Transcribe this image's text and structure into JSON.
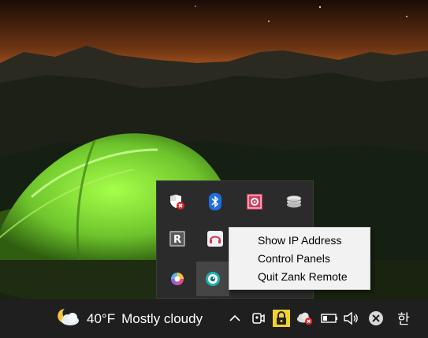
{
  "context_menu": {
    "items": [
      {
        "label": "Show IP Address"
      },
      {
        "label": "Control Panels"
      },
      {
        "label": "Quit Zank Remote"
      }
    ]
  },
  "tray_overflow": {
    "icons": [
      {
        "icon": "windows-security-shield-icon"
      },
      {
        "icon": "bluetooth-icon"
      },
      {
        "icon": "red-settings-app-icon"
      },
      {
        "icon": "disk-stack-icon"
      },
      {
        "icon": "r-app-icon"
      },
      {
        "icon": "headset-icon"
      },
      {
        "icon": "color-wheel-icon"
      },
      {
        "icon": "zank-remote-icon"
      }
    ]
  },
  "taskbar": {
    "weather": {
      "temperature": "40°F",
      "condition": "Mostly cloudy",
      "icon": "partly-cloudy-icon"
    },
    "system_icons": [
      "chevron-up-icon",
      "meet-now-icon",
      "lock-icon",
      "onedrive-error-icon",
      "battery-icon",
      "volume-icon",
      "close-circle-icon"
    ],
    "ime_indicator": "한"
  },
  "colors": {
    "taskbar": "#1f1f1f",
    "flyout": "#2b2b2b",
    "menu": "#f2f2f2",
    "tent": "#7fd23a"
  }
}
